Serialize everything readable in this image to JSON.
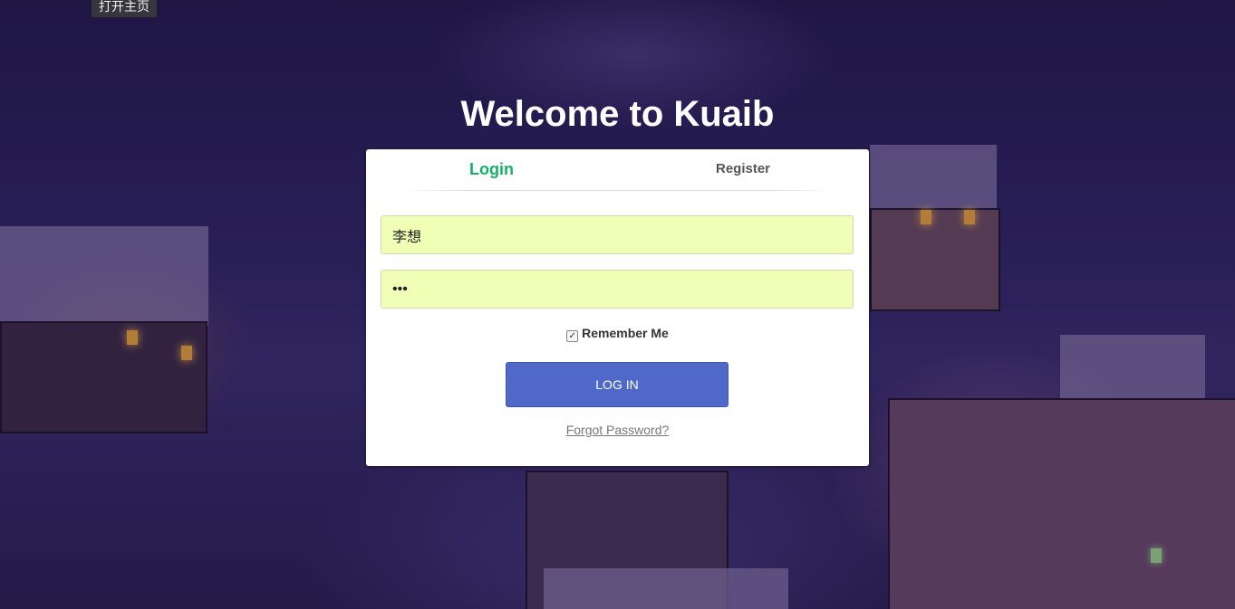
{
  "top_label": "打开主页",
  "title": "Welcome to Kuaib",
  "tabs": {
    "login": "Login",
    "register": "Register"
  },
  "form": {
    "username_value": "李想",
    "password_value": "•••",
    "remember_label": "Remember Me",
    "remember_checked": true,
    "login_button": "LOG IN",
    "forgot_link": "Forgot Password?"
  },
  "colors": {
    "active_tab": "#16b067",
    "button": "#5069c8",
    "input_bg": "#f1ffb6"
  }
}
